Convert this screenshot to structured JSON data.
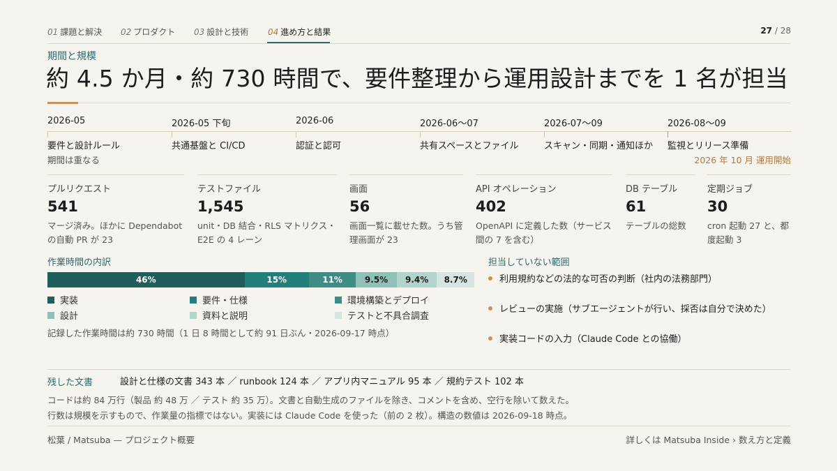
{
  "nav": {
    "tabs": [
      {
        "num": "01",
        "label": "課題と解決"
      },
      {
        "num": "02",
        "label": "プロダクト"
      },
      {
        "num": "03",
        "label": "設計と技術"
      },
      {
        "num": "04",
        "label": "進め方と結果"
      }
    ],
    "active_index": 3
  },
  "pager": {
    "current": "27",
    "sep": "/",
    "total": "28"
  },
  "header": {
    "kicker": "期間と規模",
    "title": "約 4.5 か月・約 730 時間で、要件整理から運用設計までを 1 名が担当"
  },
  "timeline": {
    "phases": [
      {
        "date": "2026-05",
        "label": "要件と設計ルール"
      },
      {
        "date": "2026-05 下旬",
        "label": "共通基盤と CI/CD"
      },
      {
        "date": "2026-06",
        "label": "認証と認可"
      },
      {
        "date": "2026-06〜07",
        "label": "共有スペースとファイル"
      },
      {
        "date": "2026-07〜09",
        "label": "スキャン・同期・通知ほか"
      },
      {
        "date": "2026-08〜09",
        "label": "監視とリリース準備"
      }
    ],
    "note": "期間は重なる",
    "end_note": "2026 年 10 月 運用開始"
  },
  "metrics": [
    {
      "label": "プルリクエスト",
      "value": "541",
      "desc": "マージ済み。ほかに Dependabot の自動 PR が 23"
    },
    {
      "label": "テストファイル",
      "value": "1,545",
      "desc": "unit・DB 結合・RLS マトリクス・E2E の 4 レーン"
    },
    {
      "label": "画面",
      "value": "56",
      "desc": "画面一覧に載せた数。うち管理画面が 23"
    },
    {
      "label": "API オペレーション",
      "value": "402",
      "desc": "OpenAPI に定義した数（サービス間の 7 を含む）"
    },
    {
      "label": "DB テーブル",
      "value": "61",
      "desc": "テーブルの総数"
    },
    {
      "label": "定期ジョブ",
      "value": "30",
      "desc": "cron 起動 27 と、都度起動 3"
    }
  ],
  "breakdown": {
    "heading": "作業時間の内訳",
    "segments": [
      {
        "name": "実装",
        "percent": 46,
        "label": "46%",
        "color": "#1f5e5c",
        "text_color": "#ffffff"
      },
      {
        "name": "要件・仕様",
        "percent": 15,
        "label": "15%",
        "color": "#237f7b",
        "text_color": "#ffffff"
      },
      {
        "name": "環境構築とデプロイ",
        "percent": 11,
        "label": "11%",
        "color": "#3f8c85",
        "text_color": "#ffffff"
      },
      {
        "name": "設計",
        "percent": 9.5,
        "label": "9.5%",
        "color": "#8fc1b9",
        "text_color": "#1c1c1c"
      },
      {
        "name": "資料と説明",
        "percent": 9.4,
        "label": "9.4%",
        "color": "#b3d3cd",
        "text_color": "#1c1c1c"
      },
      {
        "name": "テストと不具合調査",
        "percent": 8.7,
        "label": "8.7%",
        "color": "#d5e6e2",
        "text_color": "#1c1c1c"
      }
    ],
    "note": "記録した作業時間は約 730 時間（1 日 8 時間として約 91 日ぶん・2026-09-17 時点）"
  },
  "scope": {
    "heading": "担当していない範囲",
    "items": [
      "利用規約などの法的な可否の判断（社内の法務部門）",
      "レビューの実施（サブエージェントが行い、採否は自分で決めた）",
      "実装コードの入力（Claude Code との協働）"
    ]
  },
  "docs": {
    "heading": "残した文書",
    "list": "設計と仕様の文書 343 本 ／ runbook 124 本 ／ アプリ内マニュアル 95 本 ／ 規約テスト 102 本",
    "line1": "コードは約 84 万行（製品 約 48 万 ／ テスト 約 35 万）。文書と自動生成のファイルを除き、コメントを含め、空行を除いて数えた。",
    "line2": "行数は規模を示すもので、作業量の指標ではない。実装には Claude Code を使った（前の 2 枚）。構造の数値は 2026-09-18 時点。"
  },
  "footer": {
    "left": "松葉 / Matsuba — プロジェクト概要",
    "right": "詳しくは Matsuba Inside › 数え方と定義"
  }
}
